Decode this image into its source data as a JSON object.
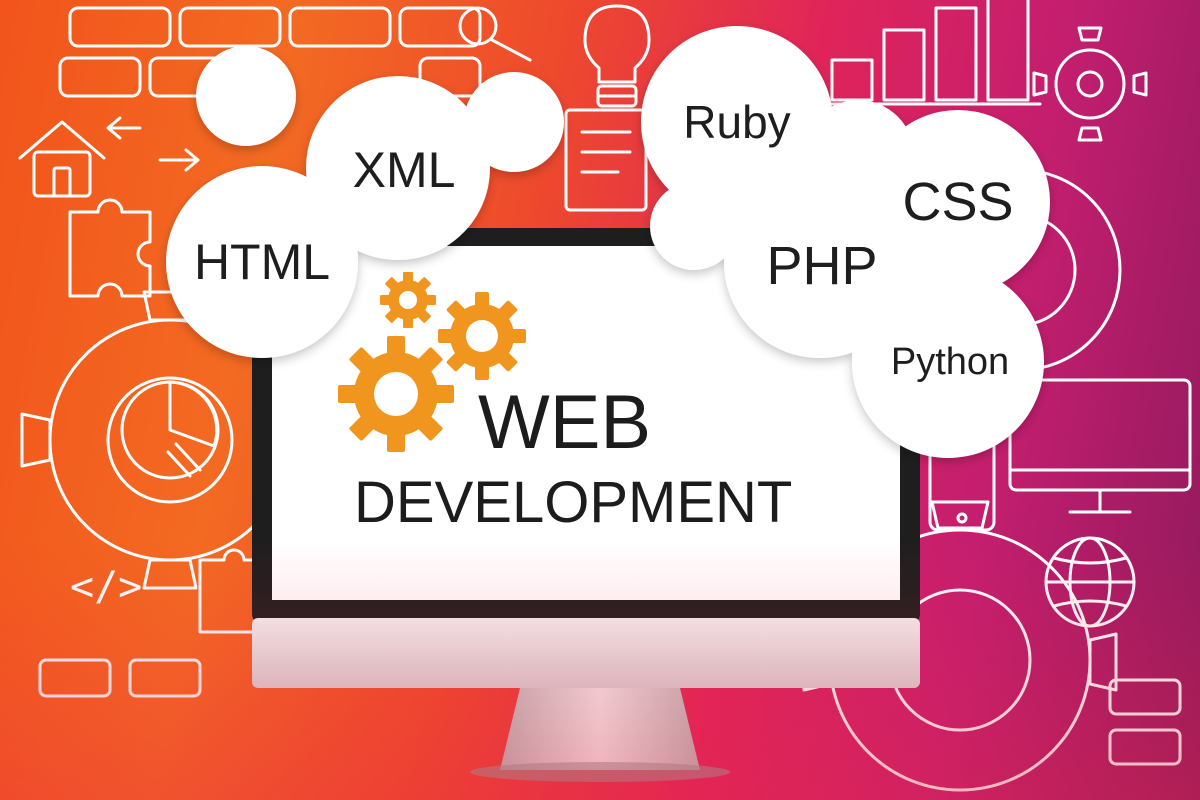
{
  "headline": {
    "line1": "WEB",
    "line2": "DEVELOPMENT"
  },
  "bubbles": {
    "html": "HTML",
    "xml": "XML",
    "ruby": "Ruby",
    "css": "CSS",
    "php": "PHP",
    "python": "Python"
  },
  "doodle_code_glyph": "</>",
  "icons": [
    "house-icon",
    "puzzle-icon",
    "brick-wall-icon",
    "magnifier-icon",
    "lightbulb-icon",
    "document-icon",
    "bar-chart-icon",
    "pie-chart-icon",
    "gear-icon",
    "globe-icon",
    "monitor-icon",
    "tablet-icon"
  ],
  "colors": {
    "bg_orange": "#f36a22",
    "bg_pink": "#e0245a",
    "bg_purple": "#8f1a5c",
    "gear_orange": "#f0961f",
    "bubble_white": "#ffffff",
    "text_dark": "#1e1e1e",
    "monitor_frame": "#1e1e1e",
    "monitor_chin": "#e6e6e6"
  }
}
